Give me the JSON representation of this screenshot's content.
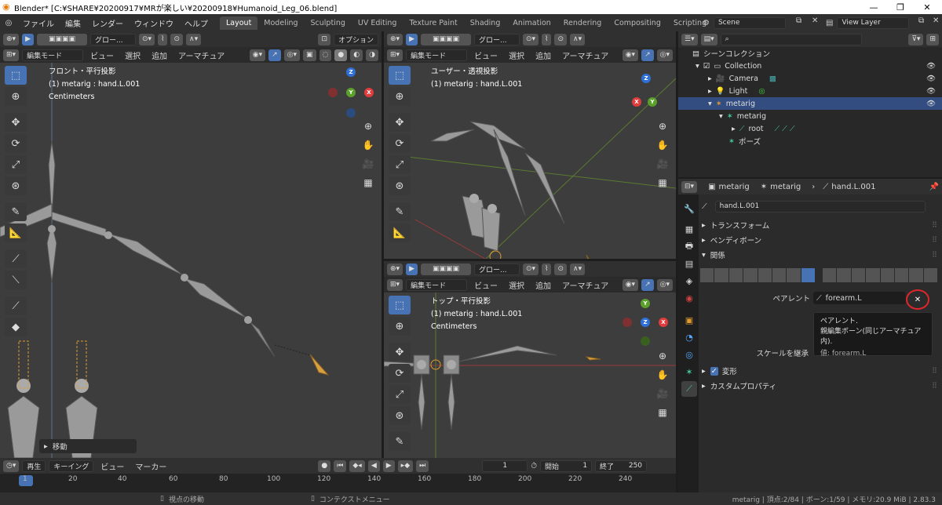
{
  "window": {
    "title": "Blender* [C:¥SHARE¥20200917¥MRが楽しい¥20200918¥Humanoid_Leg_06.blend]",
    "minimize": "—",
    "maximize": "❐",
    "close": "✕"
  },
  "menu": [
    "ファイル",
    "編集",
    "レンダー",
    "ウィンドウ",
    "ヘルプ"
  ],
  "workspaces": [
    "Layout",
    "Modeling",
    "Sculpting",
    "UV Editing",
    "Texture Paint",
    "Shading",
    "Animation",
    "Rendering",
    "Compositing",
    "Scripting",
    "+"
  ],
  "scene": {
    "name": "Scene",
    "view_layer": "View Layer"
  },
  "viewport_left": {
    "orient": "グロー...",
    "options": "オプション",
    "mode": "編集モード",
    "menus": [
      "ビュー",
      "選択",
      "追加",
      "アーマチュア"
    ],
    "view_name": "フロント・平行投影",
    "object_info": "(1) metarig : hand.L.001",
    "units": "Centimeters",
    "last_op": "移動",
    "x_label": "X"
  },
  "viewport_top_right": {
    "orient": "グロー...",
    "mode": "編集モード",
    "menus": [
      "ビュー",
      "選択",
      "追加",
      "アーマチュア"
    ],
    "view_name": "ユーザー・透視投影",
    "object_info": "(1) metarig : hand.L.001"
  },
  "viewport_bottom_right": {
    "orient": "グロー...",
    "mode": "編集モード",
    "menus": [
      "ビュー",
      "選択",
      "追加",
      "アーマチュア"
    ],
    "view_name": "トップ・平行投影",
    "object_info": "(1) metarig : hand.L.001",
    "units": "Centimeters"
  },
  "gizmo": {
    "x": "X",
    "y": "Y",
    "z": "Z"
  },
  "outliner": {
    "search_placeholder": "",
    "root": "シーンコレクション",
    "items": [
      {
        "label": "Collection"
      },
      {
        "label": "Camera"
      },
      {
        "label": "Light"
      },
      {
        "label": "metarig"
      },
      {
        "label": "metarig"
      },
      {
        "label": "root"
      },
      {
        "label": "ポーズ"
      }
    ]
  },
  "properties": {
    "breadcrumb": [
      "metarig",
      "metarig",
      "hand.L.001"
    ],
    "bone_name": "hand.L.001",
    "panels": [
      "トランスフォーム",
      "ベンディボーン",
      "関係",
      "変形",
      "カスタムプロパティ"
    ],
    "parent_label": "ペアレント",
    "parent_value": "forearm.L",
    "clear": "✕",
    "scale_label": "スケールを継承",
    "tooltip": {
      "title": "ペアレント.",
      "desc": "親編集ボーン(同じアーマチュア内).",
      "value": "値: forearm.L"
    },
    "colors": {
      "highlight": "#4772b3",
      "circle": "#e0262b"
    }
  },
  "timeline": {
    "menus": [
      "再生",
      "キーイング",
      "ビュー",
      "マーカー"
    ],
    "current_frame": "1",
    "start_label": "開始",
    "start": "1",
    "end_label": "終了",
    "end": "250",
    "ticks": [
      "1",
      "20",
      "40",
      "60",
      "80",
      "100",
      "120",
      "140",
      "160",
      "180",
      "200",
      "220",
      "240"
    ]
  },
  "status": {
    "hint1": "視点の移動",
    "hint2": "コンテクストメニュー",
    "info": "metarig | 頂点:2/84 | ボーン:1/59 | メモリ:20.9 MiB | 2.83.3"
  }
}
